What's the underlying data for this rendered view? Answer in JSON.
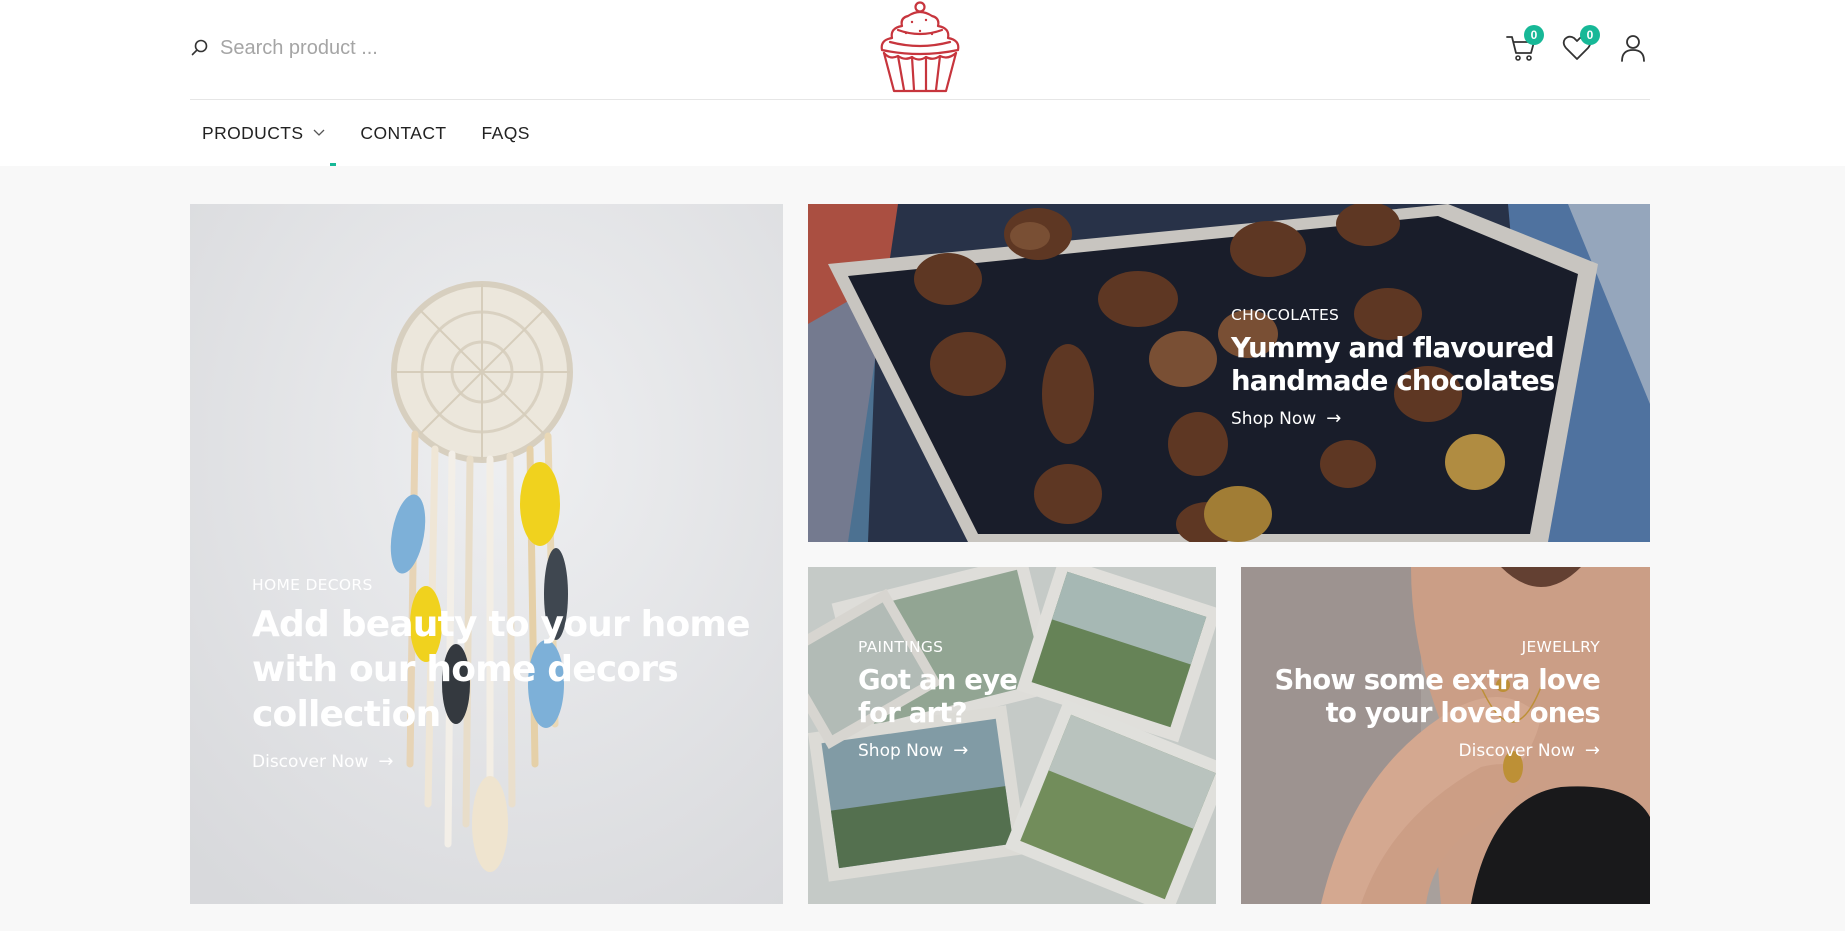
{
  "search": {
    "placeholder": "Search product ..."
  },
  "header": {
    "cart_count": "0",
    "wishlist_count": "0"
  },
  "nav": {
    "items": [
      {
        "label": "PRODUCTS"
      },
      {
        "label": "CONTACT"
      },
      {
        "label": "FAQS"
      }
    ]
  },
  "banners": [
    {
      "category": "HOME DECORS",
      "headline": "Add beauty to your home with our home decors collection",
      "cta": "Discover Now"
    },
    {
      "category": "CHOCOLATES",
      "headline": "Yummy and flavoured handmade chocolates",
      "cta": "Shop Now"
    },
    {
      "category": "PAINTINGS",
      "headline": "Got an eye for art?",
      "cta": "Shop Now"
    },
    {
      "category": "JEWELLRY",
      "headline": "Show some extra love to your loved ones",
      "cta": "Discover Now"
    }
  ],
  "colors": {
    "accent": "#17b897",
    "logo": "#c7353d"
  }
}
